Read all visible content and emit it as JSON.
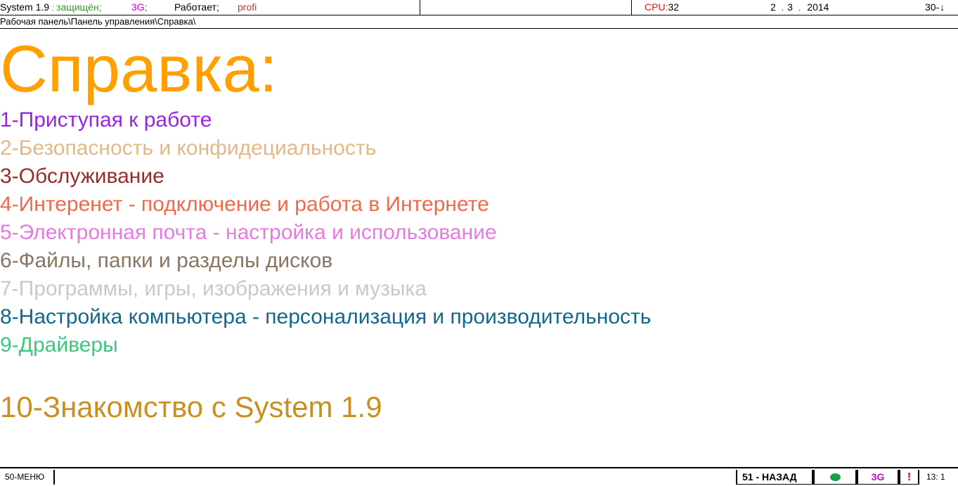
{
  "topbar": {
    "system_name": "System 1.9",
    "colon": " : ",
    "protection_status": "защищён;",
    "network_label": "3G;",
    "work_status": "Работает;",
    "mode": "profi",
    "cpu_label": "CPU:",
    "cpu_value": "32",
    "date_day": "2",
    "date_month": "3",
    "date_year": "2014",
    "date_dot": ".",
    "battery": "30-",
    "battery_arrow": "↓"
  },
  "breadcrumb": "Рабочая панель\\Панель управления\\Справка\\",
  "page_title": "Справка:",
  "menu": [
    {
      "label": "1-Приступая к работе",
      "color": "#9a22e8"
    },
    {
      "label": "2-Безопасность и конфидециальность",
      "color": "#e3b888"
    },
    {
      "label": "3-Обслуживание",
      "color": "#9c2a28"
    },
    {
      "label": "4-Интеренет - подключение и работа в Интернете",
      "color": "#f2684a"
    },
    {
      "label": "5-Электронная почта - настройка и использование",
      "color": "#e77ae0"
    },
    {
      "label": "6-Файлы, папки и разделы дисков",
      "color": "#8a7560"
    },
    {
      "label": "7-Программы, игры, изображения и музыка",
      "color": "#c5cdc2"
    },
    {
      "label": "8-Настройка компьютера - персонализация и производительность",
      "color": "#12688c"
    },
    {
      "label": "9-Драйверы",
      "color": "#3cc87c"
    },
    {
      "label": "10-Знакомство с System 1.9",
      "color": "#c99020"
    }
  ],
  "colors": {
    "title": "#ff9f00",
    "protection_status": "#2e9a1e",
    "network": "#d000d0",
    "mode": "#e03020",
    "cpu_label": "#d81818",
    "status_dot": "#1aa04a",
    "alert": "#e00000"
  },
  "bottombar": {
    "menu_label": "50-МЕНЮ",
    "back_label": "51 - НАЗАД",
    "status_icon": "green-dot-icon",
    "network_label": "3G",
    "alert_label": "!",
    "time": "13:  1"
  }
}
